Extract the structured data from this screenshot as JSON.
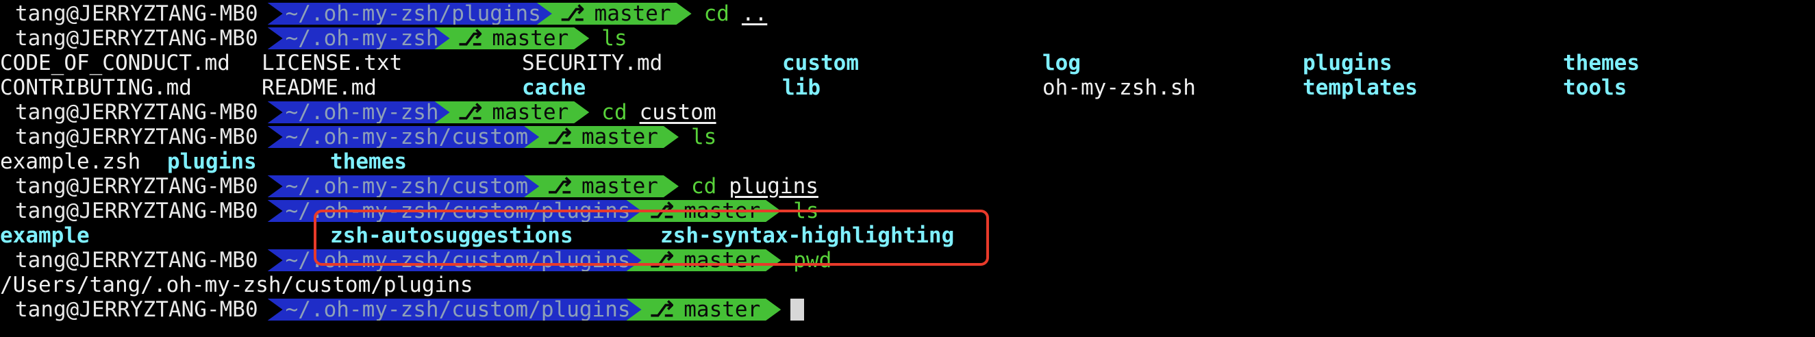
{
  "prompt": {
    "user_host": "tang@JERRYZTANG-MB0",
    "branch_icon": "⎇",
    "branch": "master"
  },
  "lines": [
    {
      "path": "~/.oh-my-zsh/plugins",
      "cmd": "cd",
      "arg": ".."
    },
    {
      "path": "~/.oh-my-zsh",
      "cmd": "ls",
      "arg": ""
    },
    {
      "path": "~/.oh-my-zsh",
      "cmd": "cd",
      "arg": "custom"
    },
    {
      "path": "~/.oh-my-zsh/custom",
      "cmd": "ls",
      "arg": ""
    },
    {
      "path": "~/.oh-my-zsh/custom",
      "cmd": "cd",
      "arg": "plugins"
    },
    {
      "path": "~/.oh-my-zsh/custom/plugins",
      "cmd": "ls",
      "arg": ""
    },
    {
      "path": "~/.oh-my-zsh/custom/plugins",
      "cmd": "pwd",
      "arg": ""
    },
    {
      "path": "~/.oh-my-zsh/custom/plugins",
      "cmd": "",
      "arg": ""
    }
  ],
  "ls_root": {
    "row1": [
      "CODE_OF_CONDUCT.md",
      "LICENSE.txt",
      "SECURITY.md",
      "custom",
      "log",
      "plugins",
      "themes"
    ],
    "row2": [
      "CONTRIBUTING.md",
      "README.md",
      "cache",
      "lib",
      "oh-my-zsh.sh",
      "templates",
      "tools"
    ]
  },
  "ls_custom": [
    "example.zsh",
    "plugins",
    "themes"
  ],
  "ls_plugins": [
    "example",
    "zsh-autosuggestions",
    "zsh-syntax-highlighting"
  ],
  "pwd_output": "/Users/tang/.oh-my-zsh/custom/plugins",
  "colors": {
    "path_segment": "#1f2dc8",
    "git_segment": "#45c036",
    "command": "#58d23a",
    "directory": "#7ff0ff",
    "highlight": "#e83a2a"
  }
}
